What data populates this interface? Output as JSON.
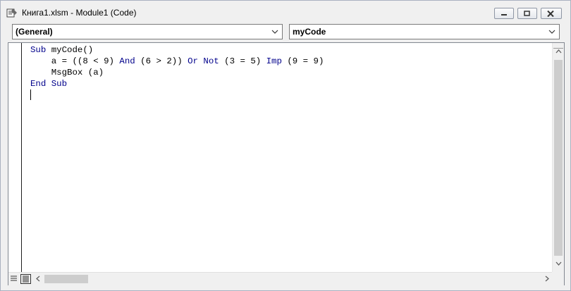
{
  "window": {
    "title": "Книга1.xlsm - Module1 (Code)"
  },
  "combos": {
    "object": "(General)",
    "procedure": "myCode"
  },
  "code": {
    "lines": [
      [
        {
          "t": "Sub",
          "k": true
        },
        {
          "t": " myCode()",
          "k": false
        }
      ],
      [
        {
          "t": "    a = ((8 < 9) ",
          "k": false
        },
        {
          "t": "And",
          "k": true
        },
        {
          "t": " (6 > 2)) ",
          "k": false
        },
        {
          "t": "Or",
          "k": true
        },
        {
          "t": " ",
          "k": false
        },
        {
          "t": "Not",
          "k": true
        },
        {
          "t": " (3 = 5) ",
          "k": false
        },
        {
          "t": "Imp",
          "k": true
        },
        {
          "t": " (9 = 9)",
          "k": false
        }
      ],
      [
        {
          "t": "    MsgBox (a)",
          "k": false
        }
      ],
      [
        {
          "t": "End",
          "k": true
        },
        {
          "t": " ",
          "k": false
        },
        {
          "t": "Sub",
          "k": true
        }
      ]
    ]
  },
  "colors": {
    "keyword": "#00008b",
    "text": "#000000"
  }
}
